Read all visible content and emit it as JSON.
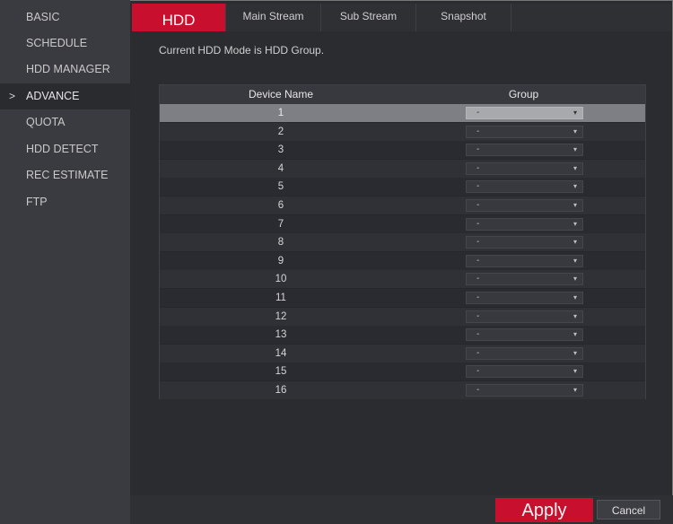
{
  "sidebar": {
    "items": [
      {
        "label": "BASIC"
      },
      {
        "label": "SCHEDULE"
      },
      {
        "label": "HDD MANAGER"
      },
      {
        "label": "ADVANCE"
      },
      {
        "label": "QUOTA"
      },
      {
        "label": "HDD DETECT"
      },
      {
        "label": "REC ESTIMATE"
      },
      {
        "label": "FTP"
      }
    ],
    "active_arrow": ">"
  },
  "tabs": [
    {
      "label": "HDD"
    },
    {
      "label": "Main Stream"
    },
    {
      "label": "Sub Stream"
    },
    {
      "label": "Snapshot"
    }
  ],
  "mode_text": "Current HDD Mode is HDD Group.",
  "table": {
    "headers": {
      "device_name": "Device Name",
      "group": "Group"
    },
    "rows": [
      {
        "name": "1",
        "group": "-"
      },
      {
        "name": "2",
        "group": "-"
      },
      {
        "name": "3",
        "group": "-"
      },
      {
        "name": "4",
        "group": "-"
      },
      {
        "name": "5",
        "group": "-"
      },
      {
        "name": "6",
        "group": "-"
      },
      {
        "name": "7",
        "group": "-"
      },
      {
        "name": "8",
        "group": "-"
      },
      {
        "name": "9",
        "group": "-"
      },
      {
        "name": "10",
        "group": "-"
      },
      {
        "name": "11",
        "group": "-"
      },
      {
        "name": "12",
        "group": "-"
      },
      {
        "name": "13",
        "group": "-"
      },
      {
        "name": "14",
        "group": "-"
      },
      {
        "name": "15",
        "group": "-"
      },
      {
        "name": "16",
        "group": "-"
      }
    ]
  },
  "buttons": {
    "apply": "Apply",
    "cancel": "Cancel"
  },
  "colors": {
    "accent": "#c8102e",
    "background": "#2b2c30",
    "sidebar": "#3a3b40"
  },
  "icons": {
    "dropdown": "chevron-down-icon",
    "active_marker": "chevron-right-icon"
  }
}
